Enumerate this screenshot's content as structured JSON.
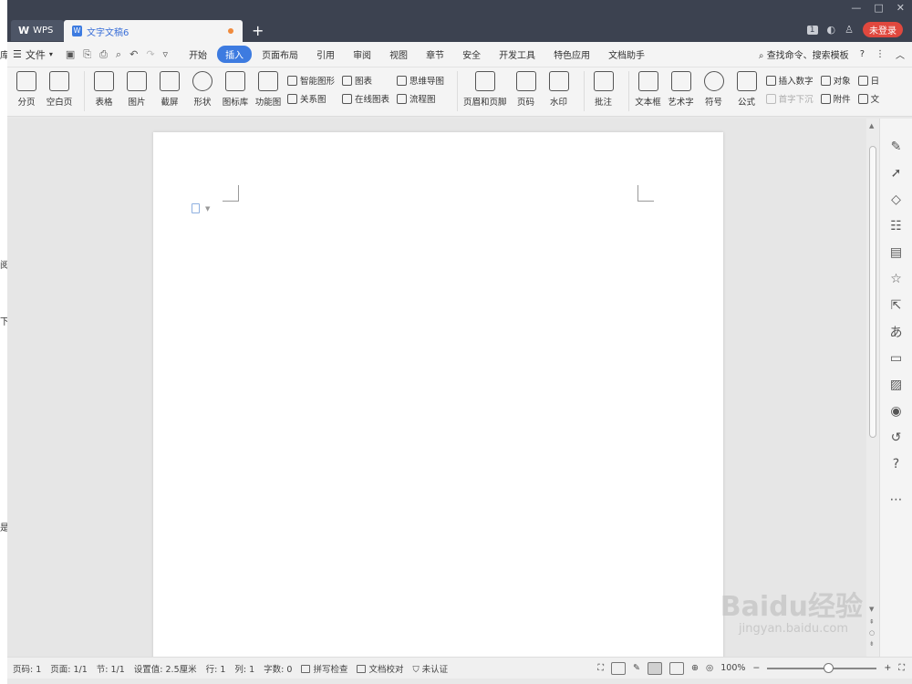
{
  "tabs": {
    "home_label": "WPS",
    "doc_label": "文字文稿6",
    "add_label": "+"
  },
  "window": {
    "badge": "1",
    "login_label": "未登录"
  },
  "menubar": {
    "file_label": "文件",
    "items": [
      "开始",
      "插入",
      "页面布局",
      "引用",
      "审阅",
      "视图",
      "章节",
      "安全",
      "开发工具",
      "特色应用",
      "文档助手"
    ],
    "active_item": "插入",
    "search_label": "查找命令、搜索模板",
    "help_label": "?"
  },
  "ribbon": {
    "page_break": "分页",
    "blank_page": "空白页",
    "table": "表格",
    "picture": "图片",
    "screenshot": "截屏",
    "shape": "形状",
    "icon_lib": "图标库",
    "func_chart": "功能图",
    "smart_art": "智能图形",
    "chart": "图表",
    "mind_map": "思维导图",
    "relation": "关系图",
    "online_chart": "在线图表",
    "flowchart": "流程图",
    "header_footer": "页眉和页脚",
    "page_num": "页码",
    "watermark": "水印",
    "comment": "批注",
    "textbox": "文本框",
    "wordart": "艺术字",
    "symbol": "符号",
    "formula": "公式",
    "insert_number": "插入数字",
    "drop_cap": "首字下沉",
    "object": "对象",
    "attachment": "附件",
    "date_cut": "日",
    "doc_cut": "文"
  },
  "statusbar": {
    "page_no": "页码: 1",
    "pages": "页面: 1/1",
    "section": "节: 1/1",
    "setting": "设置值: 2.5厘米",
    "row": "行: 1",
    "col": "列: 1",
    "wordcount": "字数: 0",
    "spellcheck": "拼写检查",
    "doc_check": "文档校对",
    "cert": "未认证",
    "zoom": "100%",
    "zoom_level": 1.0
  },
  "watermark": {
    "brand": "Baidu经验",
    "url": "jingyan.baidu.com"
  },
  "background": {
    "chars": [
      "库",
      "阅",
      "下",
      "是"
    ]
  }
}
